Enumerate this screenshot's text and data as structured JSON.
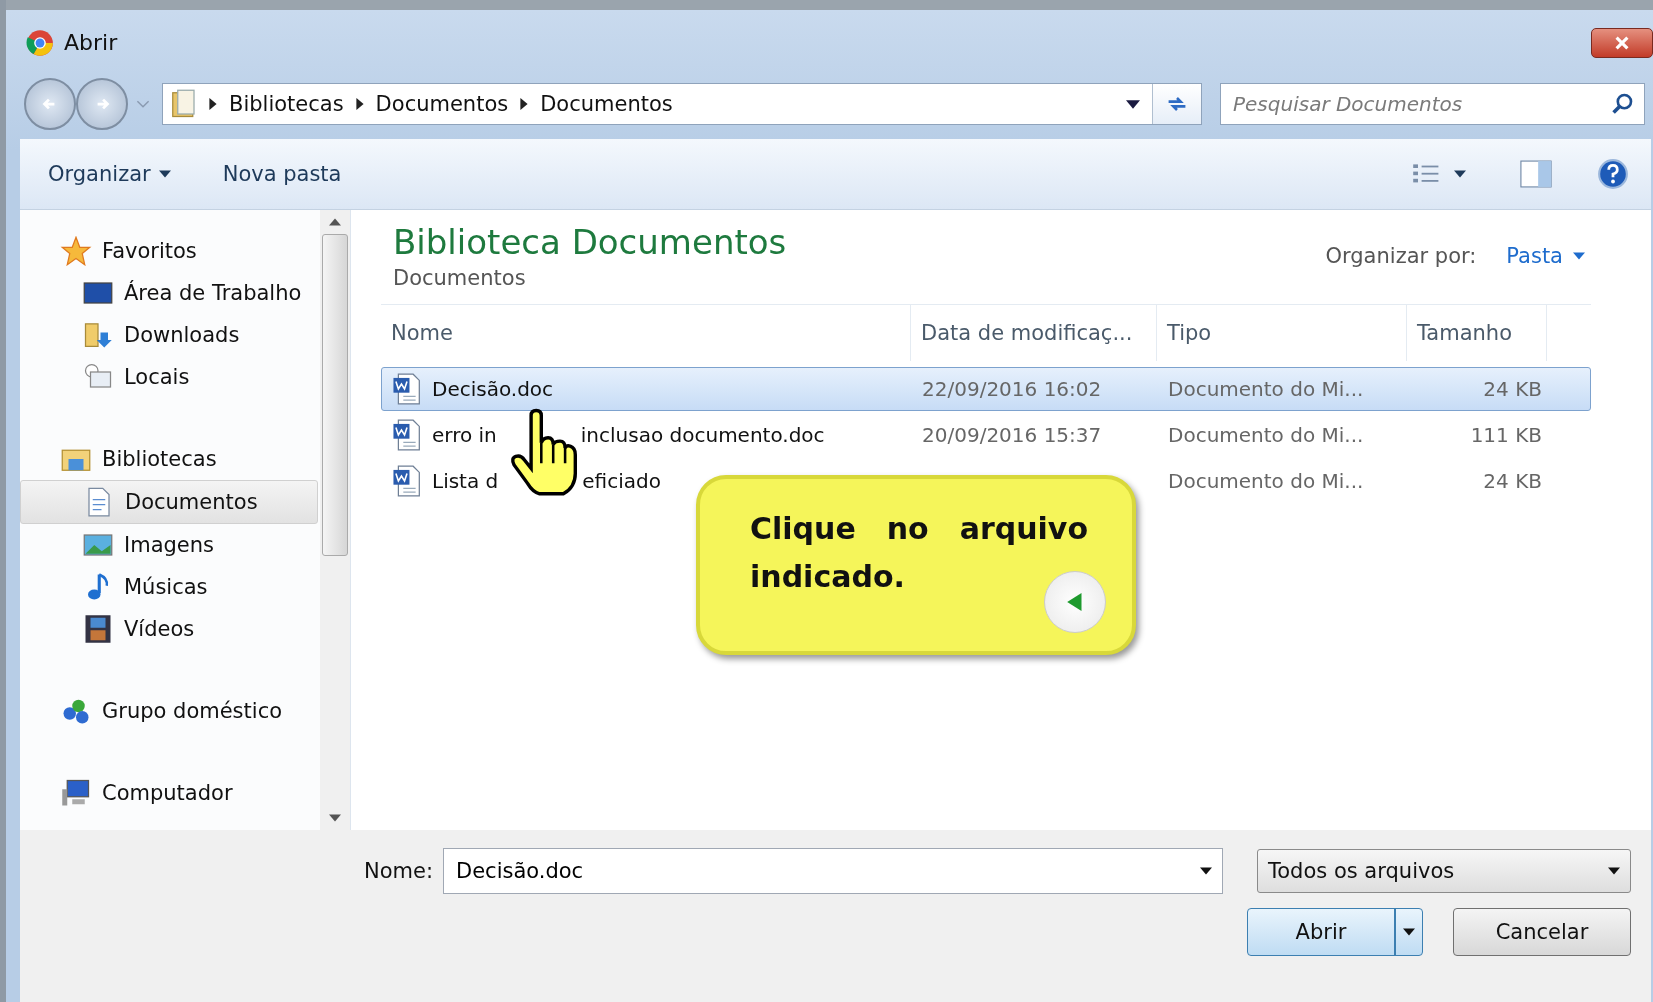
{
  "window": {
    "title": "Abrir"
  },
  "breadcrumb": [
    "Bibliotecas",
    "Documentos",
    "Documentos"
  ],
  "search": {
    "placeholder": "Pesquisar Documentos"
  },
  "toolbar": {
    "organize": "Organizar",
    "new_folder": "Nova pasta"
  },
  "sidebar": {
    "groups": [
      {
        "label": "Favoritos",
        "kind": "star",
        "selected": false,
        "children": [
          {
            "label": "Área de Trabalho",
            "kind": "desktop",
            "selected": false
          },
          {
            "label": "Downloads",
            "kind": "download",
            "selected": false
          },
          {
            "label": "Locais",
            "kind": "recent",
            "selected": false
          }
        ]
      },
      {
        "label": "Bibliotecas",
        "kind": "library",
        "selected": false,
        "children": [
          {
            "label": "Documentos",
            "kind": "document",
            "selected": true
          },
          {
            "label": "Imagens",
            "kind": "picture",
            "selected": false
          },
          {
            "label": "Músicas",
            "kind": "music",
            "selected": false
          },
          {
            "label": "Vídeos",
            "kind": "video",
            "selected": false
          }
        ]
      },
      {
        "label": "Grupo doméstico",
        "kind": "homegroup",
        "selected": false
      },
      {
        "label": "Computador",
        "kind": "computer",
        "selected": false
      }
    ]
  },
  "library": {
    "title": "Biblioteca Documentos",
    "subtitle": "Documentos",
    "arrange_label": "Organizar por:",
    "arrange_value": "Pasta"
  },
  "table": {
    "columns": [
      "Nome",
      "Data de modificaç...",
      "Tipo",
      "Tamanho"
    ],
    "rows": [
      {
        "name_parts": [
          "Decisão.doc"
        ],
        "date": "22/09/2016 16:02",
        "type": "Documento do Mi...",
        "size": "24 KB",
        "selected": true
      },
      {
        "name_parts": [
          "erro in",
          "inclusao documento.doc"
        ],
        "date": "20/09/2016 15:37",
        "type": "Documento do Mi...",
        "size": "111 KB",
        "selected": false
      },
      {
        "name_parts": [
          "Lista d",
          "eficiado"
        ],
        "type": "Documento do Mi...",
        "size": "24 KB",
        "selected": false
      }
    ]
  },
  "footer": {
    "name_label": "Nome:",
    "name_value": "Decisão.doc",
    "filter": "Todos os arquivos",
    "open": "Abrir",
    "cancel": "Cancelar"
  },
  "callout": {
    "text": "Clique no arquivo indicado."
  }
}
